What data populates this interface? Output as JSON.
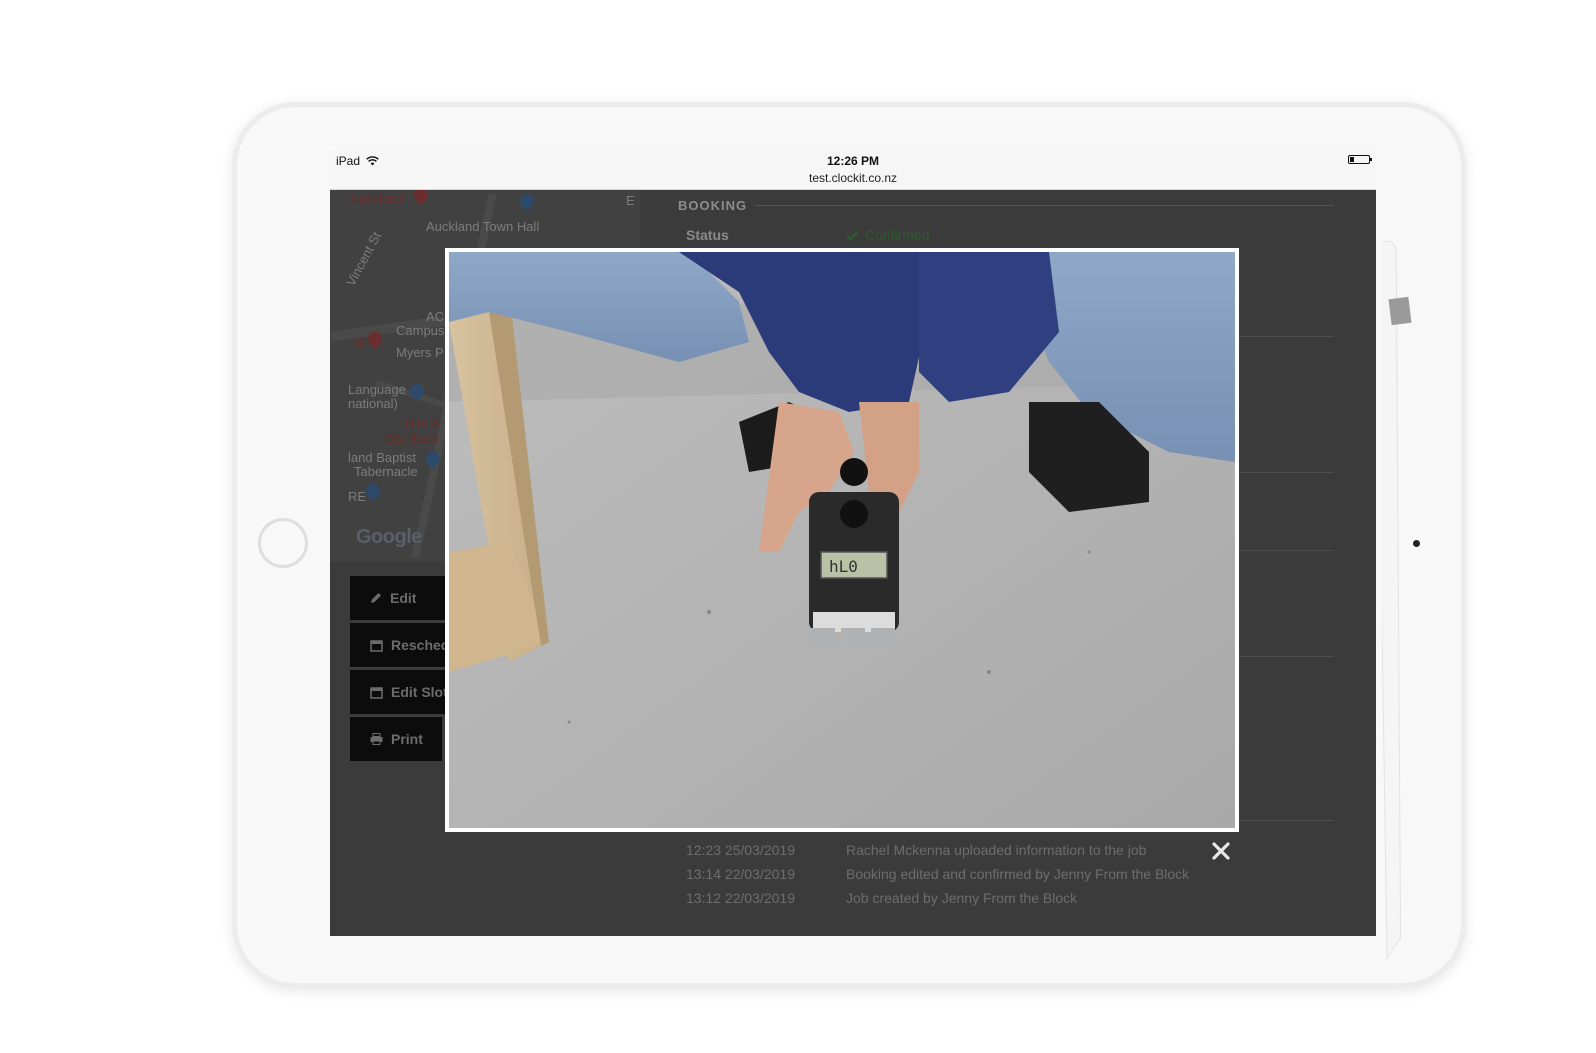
{
  "statusbar": {
    "device": "iPad",
    "time": "12:26 PM",
    "url": "test.clockit.co.nz"
  },
  "map": {
    "labels": {
      "auckland": "Auckland",
      "town_hall": "Auckland Town Hall",
      "vincent": "Vincent St",
      "ac": "AC",
      "campus": "Campus",
      "myers": "Myers P",
      "nd": "nd",
      "language": "Language",
      "national": "national)",
      "yha": "YHA A",
      "city_back": "City Back",
      "baptist": "land Baptist",
      "tabernacle": "Tabernacle",
      "re": "RE",
      "e": "E",
      "google": "Google"
    }
  },
  "actions": {
    "edit": "Edit",
    "reschedule": "Resched",
    "edit_slots": "Edit Slot",
    "print": "Print"
  },
  "booking": {
    "section_title": "BOOKING",
    "status_label": "Status",
    "status_value": "Confirmed"
  },
  "activity_log": [
    {
      "time": "12:23 25/03/2019",
      "message": "Rachel Mckenna uploaded information to the job"
    },
    {
      "time": "13:14 22/03/2019",
      "message": "Booking edited and confirmed by Jenny From the Block"
    },
    {
      "time": "13:12 22/03/2019",
      "message": "Job created by Jenny From the Block"
    }
  ],
  "colors": {
    "screen_overlay": "#3b3b3b",
    "confirmed_green": "#2f5a2f",
    "button_bg": "#0c0c0c"
  }
}
